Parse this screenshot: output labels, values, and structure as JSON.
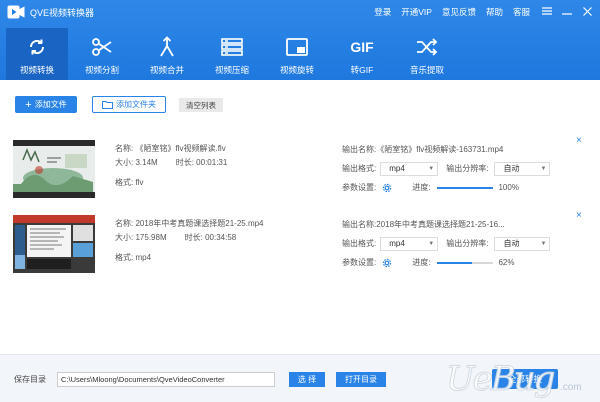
{
  "app": {
    "title": "QVE视频转换器"
  },
  "top_links": [
    "登录",
    "开通VIP",
    "意见反馈",
    "帮助",
    "客服"
  ],
  "toolbar": [
    {
      "label": "视频转换",
      "icon": "sync-icon",
      "active": true
    },
    {
      "label": "视频分割",
      "icon": "scissors-icon",
      "active": false
    },
    {
      "label": "视频合并",
      "icon": "merge-icon",
      "active": false
    },
    {
      "label": "视频压缩",
      "icon": "compress-icon",
      "active": false
    },
    {
      "label": "视频旋转",
      "icon": "rotate-icon",
      "active": false
    },
    {
      "label": "转GIF",
      "icon": "gif-icon",
      "active": false,
      "glyph": "GIF"
    },
    {
      "label": "音乐提取",
      "icon": "shuffle-icon",
      "active": false
    }
  ],
  "actions": {
    "add_file": "添加文件",
    "add_folder": "添加文件夹",
    "clear_list": "清空列表"
  },
  "labels": {
    "name": "名称:",
    "size": "大小:",
    "duration": "时长:",
    "format": "格式:",
    "output_name": "输出名称:",
    "output_format": "输出格式:",
    "output_resolution": "输出分辨率:",
    "params": "参数设置:",
    "progress": "进度:"
  },
  "files": [
    {
      "name": "《陋室铭》flv视频解读.flv",
      "size": "3.14M",
      "duration": "00:01:31",
      "format": "flv",
      "output_name": "《陋室铭》flv视频解读-163731.mp4",
      "output_format": "mp4",
      "output_resolution": "自动",
      "progress": 100,
      "progress_text": "100%"
    },
    {
      "name": "2018年中考真题课选择题21-25.mp4",
      "size": "175.98M",
      "duration": "00:34:58",
      "format": "mp4",
      "output_name": "2018年中考真题课选择题21-25-16...",
      "output_format": "mp4",
      "output_resolution": "自动",
      "progress": 62,
      "progress_text": "62%"
    }
  ],
  "footer": {
    "save_dir_label": "保存目录",
    "save_dir": "C:\\Users\\Mloong\\Documents\\QveVideoConverter",
    "choose": "选 择",
    "open_dir": "打开目录",
    "start": "全部转换"
  },
  "colors": {
    "header": "#2080e6",
    "accent": "#2a83e6",
    "active_tab": "#1a64c3"
  }
}
